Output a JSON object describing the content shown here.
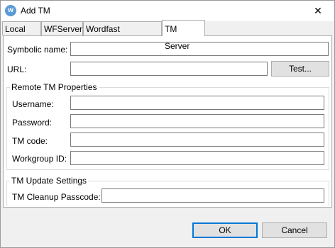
{
  "window": {
    "title": "Add TM",
    "app_icon_glyph": "w",
    "close_glyph": "✕"
  },
  "tabs": [
    {
      "label": "Local TM"
    },
    {
      "label": "WFServer"
    },
    {
      "label": "Wordfast Anywhere"
    },
    {
      "label": "TM Server",
      "active": true
    }
  ],
  "form": {
    "symbolic_name_label": "Symbolic name:",
    "symbolic_name_value": "",
    "url_label": "URL:",
    "url_value": "",
    "test_button": "Test..."
  },
  "remote": {
    "title": "Remote TM Properties",
    "username_label": "Username:",
    "username_value": "",
    "password_label": "Password:",
    "password_value": "",
    "tm_code_label": "TM code:",
    "tm_code_value": "",
    "workgroup_label": "Workgroup ID:",
    "workgroup_value": ""
  },
  "update": {
    "title": "TM Update Settings",
    "cleanup_label": "TM Cleanup Passcode:",
    "cleanup_value": ""
  },
  "footer": {
    "ok": "OK",
    "cancel": "Cancel"
  },
  "colors": {
    "accent": "#0078d7",
    "icon": "#5b9bd5"
  }
}
